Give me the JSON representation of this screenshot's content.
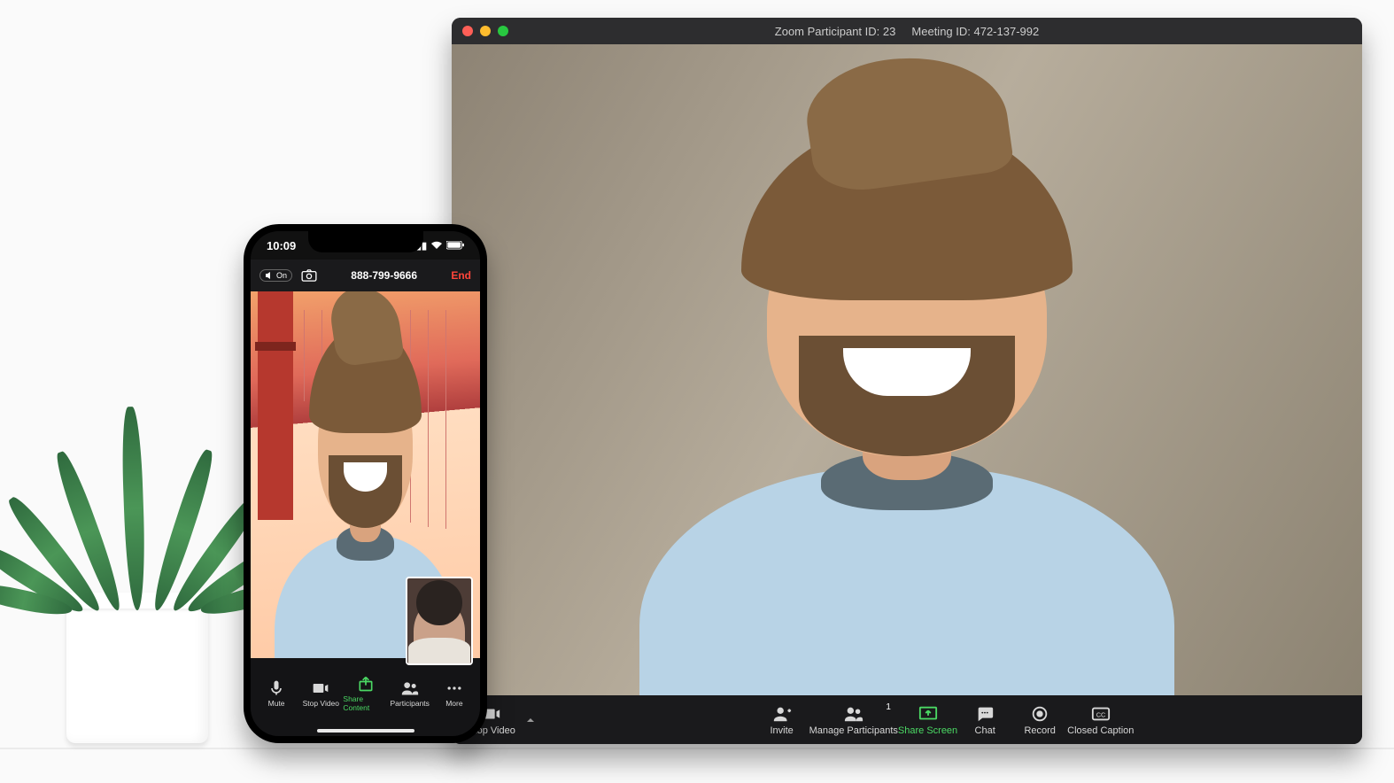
{
  "desktop": {
    "titlebar": {
      "participant_label": "Zoom Participant ID: 23",
      "meeting_label": "Meeting ID: 472-137-992"
    },
    "toolbar": {
      "stop_video": "Stop Video",
      "invite": "Invite",
      "manage_participants": "Manage Participants",
      "participants_count": "1",
      "share_screen": "Share Screen",
      "chat": "Chat",
      "record": "Record",
      "closed_caption": "Closed Caption"
    }
  },
  "phone": {
    "status": {
      "time": "10:09"
    },
    "nav": {
      "speaker_on": "On",
      "number": "888-799-9666",
      "end": "End"
    },
    "toolbar": {
      "mute": "Mute",
      "stop_video": "Stop Video",
      "share_content": "Share Content",
      "participants": "Participants",
      "more": "More"
    }
  }
}
